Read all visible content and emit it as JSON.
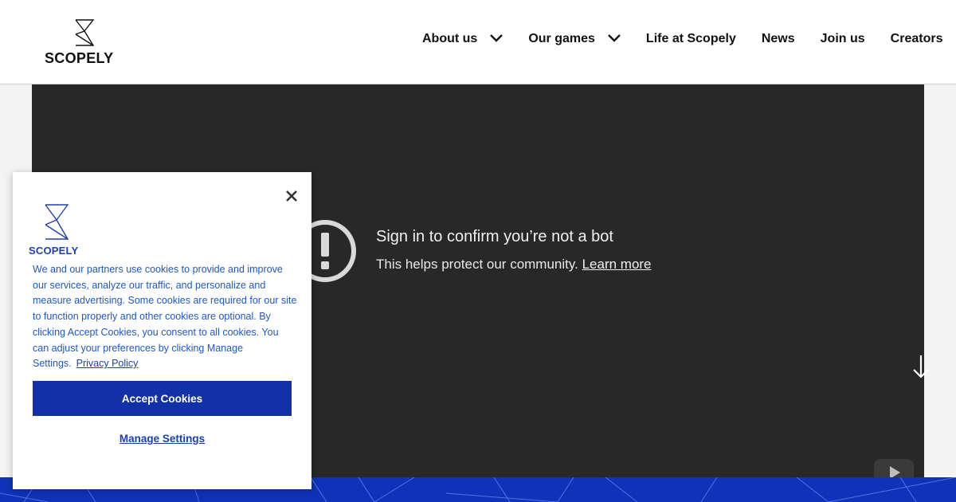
{
  "brand": {
    "name": "SCOPELY",
    "accent": "#0f32b8"
  },
  "nav": {
    "items": [
      {
        "label": "About us",
        "has_dropdown": true,
        "icon": "chevron-down-icon"
      },
      {
        "label": "Our games",
        "has_dropdown": true,
        "icon": "chevron-down-icon"
      },
      {
        "label": "Life at Scopely",
        "has_dropdown": false
      },
      {
        "label": "News",
        "has_dropdown": false
      },
      {
        "label": "Join us",
        "has_dropdown": false
      },
      {
        "label": "Creators",
        "has_dropdown": false
      }
    ]
  },
  "video": {
    "title": "Sign in to confirm you’re not a bot",
    "subtitle": "This helps protect our community.",
    "learn_more": "Learn more",
    "icon": "exclamation-circle-icon",
    "platform_icon": "youtube-icon"
  },
  "cookie": {
    "logo_text": "SCOPELY",
    "text": "We and our partners use cookies to provide and improve our services, analyze our traffic, and personalize and measure advertising. Some cookies are required for our site to function properly and other cookies are optional. By clicking Accept Cookies, you consent to all cookies. You can adjust your preferences by clicking Manage Settings.",
    "privacy_link": "Privacy Policy",
    "accept_label": "Accept Cookies",
    "manage_label": "Manage Settings",
    "close_icon": "close-icon"
  }
}
